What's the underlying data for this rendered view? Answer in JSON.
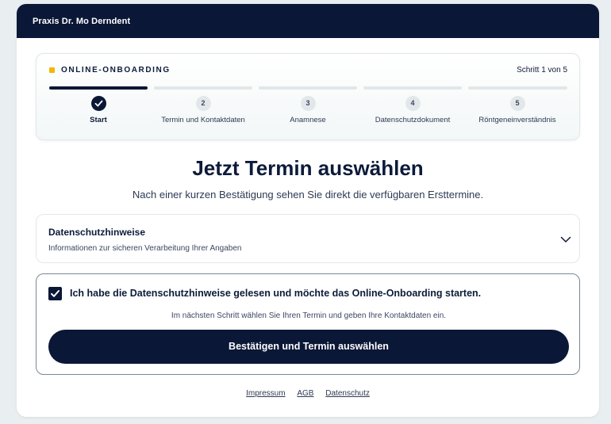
{
  "header": {
    "practice_name": "Praxis Dr. Mo Derndent"
  },
  "progress": {
    "label": "ONLINE-ONBOARDING",
    "step_count": "Schritt 1 von 5",
    "steps": [
      {
        "number": "✓",
        "label": "Start",
        "state": "done"
      },
      {
        "number": "2",
        "label": "Termin und Kontaktdaten",
        "state": "todo"
      },
      {
        "number": "3",
        "label": "Anamnese",
        "state": "todo"
      },
      {
        "number": "4",
        "label": "Datenschutzdokument",
        "state": "todo"
      },
      {
        "number": "5",
        "label": "Röntgeneinverständnis",
        "state": "todo"
      }
    ]
  },
  "main": {
    "title": "Jetzt Termin auswählen",
    "subtitle": "Nach einer kurzen Bestätigung sehen Sie direkt die verfügbaren Ersttermine."
  },
  "accordion": {
    "title": "Datenschutzhinweise",
    "subtitle": "Informationen zur sicheren Verarbeitung Ihrer Angaben"
  },
  "consent": {
    "checked": true,
    "label": "Ich habe die Datenschutzhinweise gelesen und möchte das Online-Onboarding starten.",
    "note": "Im nächsten Schritt wählen Sie Ihren Termin und geben Ihre Kontaktdaten ein.",
    "button_label": "Bestätigen und Termin auswählen"
  },
  "footer": {
    "links": [
      "Impressum",
      "AGB",
      "Datenschutz"
    ]
  },
  "colors": {
    "primary": "#0b1736",
    "accent": "#f2b705",
    "background": "#e9eef0"
  }
}
